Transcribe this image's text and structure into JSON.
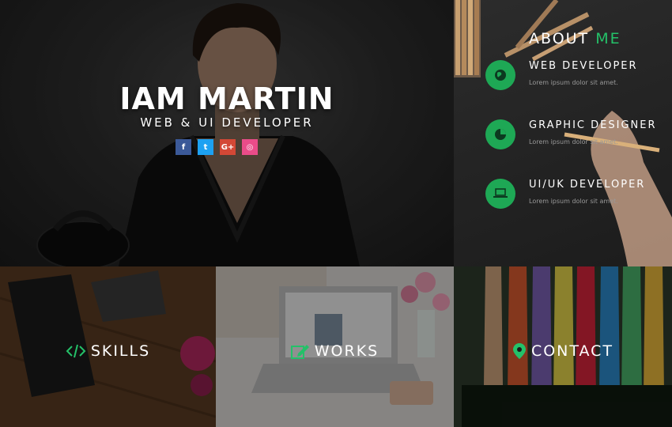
{
  "hero": {
    "name": "IAM MARTIN",
    "role": "WEB & UI DEVELOPER",
    "social": [
      {
        "icon": "facebook-icon",
        "glyph": "f"
      },
      {
        "icon": "twitter-icon",
        "glyph": "t"
      },
      {
        "icon": "google-plus-icon",
        "glyph": "G+"
      },
      {
        "icon": "dribbble-icon",
        "glyph": "◎"
      }
    ]
  },
  "about": {
    "title_prefix": "ABOUT",
    "title_accent": "ME",
    "services": [
      {
        "title": "WEB DEVELOPER",
        "desc": "Lorem ipsum dolor sit amet.",
        "icon": "globe-icon"
      },
      {
        "title": "GRAPHIC DESIGNER",
        "desc": "Lorem ipsum dolor sit amet.",
        "icon": "pie-chart-icon"
      },
      {
        "title": "UI/UK DEVELOPER",
        "desc": "Lorem ipsum dolor sit amet.",
        "icon": "laptop-icon"
      }
    ]
  },
  "tiles": {
    "skills": {
      "label": "SKILLS",
      "icon": "code-icon"
    },
    "works": {
      "label": "WORKS",
      "icon": "edit-icon"
    },
    "contact": {
      "label": "CONTACT",
      "icon": "map-marker-icon"
    }
  },
  "colors": {
    "accent": "#24c169",
    "facebook": "#3b5998",
    "twitter": "#1da1f2",
    "googleplus": "#d34836",
    "dribbble": "#ea4c89"
  }
}
